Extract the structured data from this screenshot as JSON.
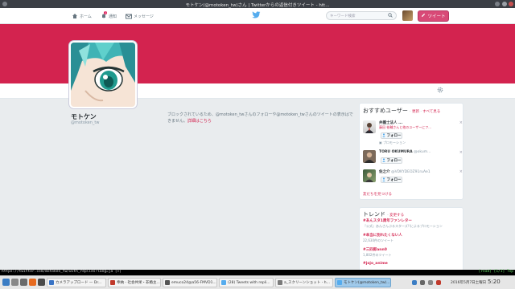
{
  "window": {
    "title": "モトケン(@motoken_tw)さん | Twitterからの返信付きツイート - htt..."
  },
  "nav": {
    "home_label": "ホーム",
    "notifications_label": "通知",
    "notifications_count": "1",
    "messages_label": "メッセージ",
    "search_placeholder": "キーワード検索",
    "tweet_label": "ツイート"
  },
  "profile": {
    "name": "モトケン",
    "handle": "@motoken_tw",
    "blocked_text": "ブロックされているため、@motoken_twさんのフォローや@motoken_twさんのツイートの表示はできません。",
    "details_link": "詳細はこちら"
  },
  "who_to_follow": {
    "title": "おすすめユーザー",
    "refresh_label": "更新",
    "view_all_label": "すべて見る",
    "follow_label": "フォロー",
    "users": [
      {
        "name": "弁護士法人 ...",
        "subtitle": "藤田 祐輔さんと他のユーザーにフ...",
        "promoted": "プロモーション"
      },
      {
        "name": "TORU OKUMURA",
        "handle": "@okum...",
        "subtitle": ""
      },
      {
        "name": "佐之介",
        "handle": "@VDKYDEOZ91ruAe1",
        "subtitle": ""
      }
    ],
    "find_friends_label": "友だちを見つける"
  },
  "trends": {
    "title": "トレンド",
    "change_label": "変更する",
    "items": [
      {
        "tag": "#あんスタ1周年ファンレター",
        "desc": "『公式』あんさんぶるスターズ!!によるプロモーション"
      },
      {
        "tag": "#本当に別れたくない人",
        "desc": "22,630件のツイート"
      },
      {
        "tag": "#三四郎ann0",
        "desc": "1,802件のツイート"
      },
      {
        "tag": "#jojo_anime",
        "desc": ""
      }
    ]
  },
  "terminal": {
    "left": "https://twitter.com/motoken_tw/with_replies?lang=ja [+]",
    "right": "[read] [1/1] Top"
  },
  "taskbar": {
    "items": [
      "カメラアップロード — Dr...",
      "奉納 - 社会共栄・非婚主...",
      "emuco24@a56-FMVD1...",
      "(28) Tweets with repli...",
      "a_スクリーンショット - h...",
      "モトケン(@motoken_tw)..."
    ],
    "date": "2016年5月7日土曜日",
    "time": "5:20"
  },
  "colors": {
    "brand": "#d3234f",
    "tweet_button": "#d84a77",
    "twitter_blue": "#55acee"
  }
}
